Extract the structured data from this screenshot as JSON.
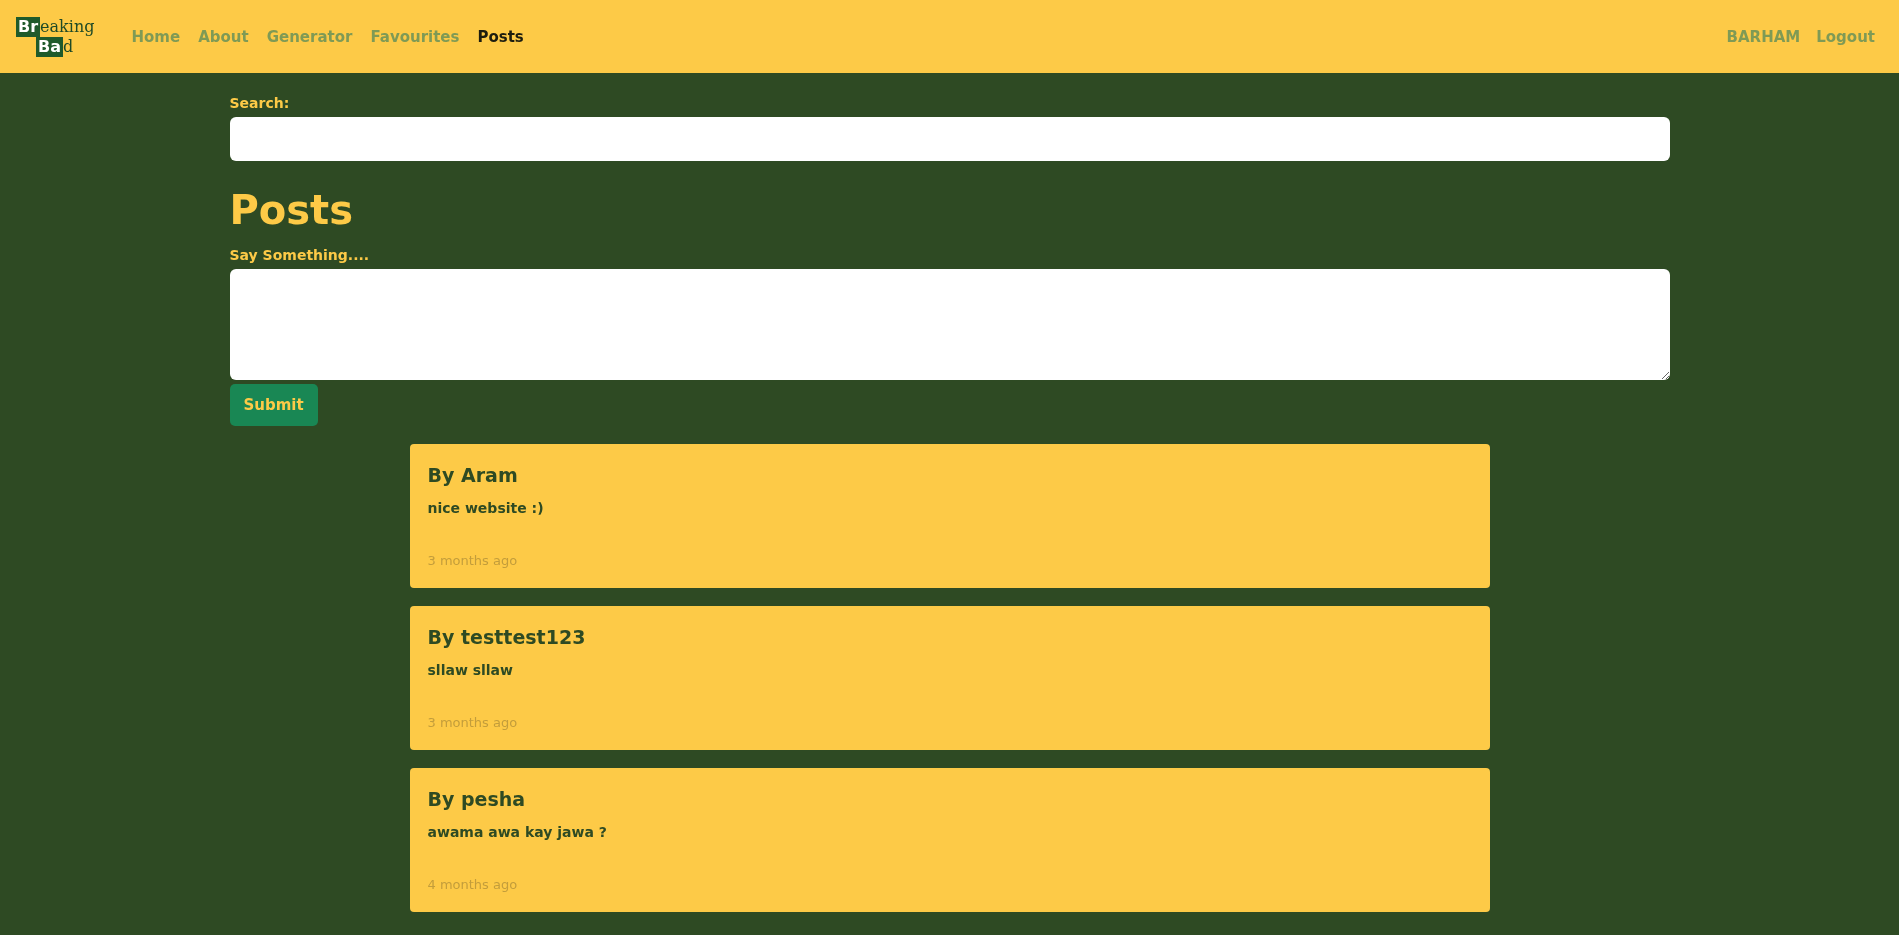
{
  "logo": {
    "lines": [
      {
        "boxed": "Br",
        "rest": "eaking"
      },
      {
        "boxed": "Ba",
        "rest": "d"
      }
    ]
  },
  "nav": [
    {
      "label": "Home",
      "selected": false
    },
    {
      "label": "About",
      "selected": false
    },
    {
      "label": "Generator",
      "selected": false
    },
    {
      "label": "Favourites",
      "selected": false
    },
    {
      "label": "Posts",
      "selected": true
    }
  ],
  "user_nav": [
    "BARHAM",
    "Logout"
  ],
  "search": {
    "label": "Search:"
  },
  "heading": "Posts",
  "composer": {
    "label": "Say Something....",
    "button": "Submit"
  },
  "posts": [
    {
      "author": "By Aram",
      "body": "nice website :)",
      "time": "3 months ago"
    },
    {
      "author": "By testtest123",
      "body": "sllaw sllaw",
      "time": "3 months ago"
    },
    {
      "author": "By pesha",
      "body": "awama awa kay jawa ?",
      "time": "4 months ago"
    }
  ]
}
